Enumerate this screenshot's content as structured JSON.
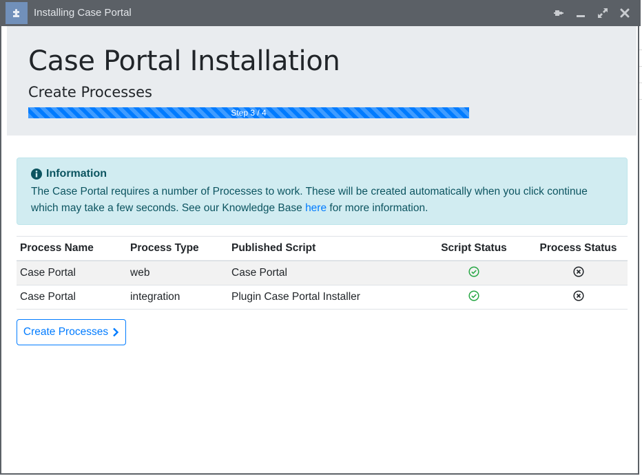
{
  "window": {
    "title": "Installing Case Portal",
    "controls": [
      "pin-icon",
      "minimize-icon",
      "maximize-icon",
      "close-icon"
    ]
  },
  "header": {
    "title": "Case Portal Installation",
    "step_title": "Create Processes",
    "progress_label": "Step 3 / 4",
    "progress_fraction": 1.0
  },
  "info": {
    "heading": "Information",
    "text_before_link": "The Case Portal requires a number of Processes to work. These will be created automatically when you click continue which may take a few seconds. See our Knowledge Base ",
    "link_text": "here",
    "text_after_link": " for more information."
  },
  "table": {
    "headers": {
      "name": "Process Name",
      "type": "Process Type",
      "script": "Published Script",
      "script_status": "Script Status",
      "process_status": "Process Status"
    },
    "rows": [
      {
        "name": "Case Portal",
        "type": "web",
        "script": "Case Portal",
        "script_status": "ok",
        "process_status": "missing"
      },
      {
        "name": "Case Portal",
        "type": "integration",
        "script": "Plugin Case Portal Installer",
        "script_status": "ok",
        "process_status": "missing"
      }
    ]
  },
  "actions": {
    "create_label": "Create Processes"
  },
  "colors": {
    "titlebar": "#5b6066",
    "accent": "#007bff",
    "success": "#28a745",
    "info_bg": "#d1ecf1",
    "info_text": "#0c5460"
  }
}
